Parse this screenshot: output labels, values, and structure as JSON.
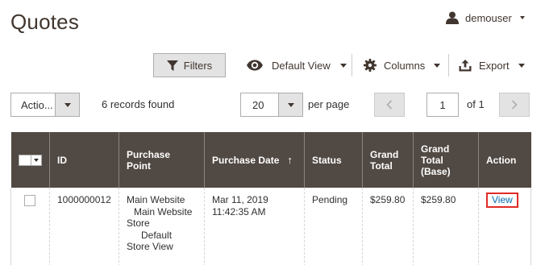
{
  "header": {
    "title": "Quotes",
    "user": {
      "name": "demouser",
      "icon": "user-icon"
    }
  },
  "toolbar": {
    "filters_label": "Filters",
    "view_label": "Default View",
    "columns_label": "Columns",
    "export_label": "Export"
  },
  "actions": {
    "label": "Actio..."
  },
  "records": {
    "text": "6 records found"
  },
  "pager": {
    "per_page_value": "20",
    "per_page_label": "per page",
    "current_page": "1",
    "of_label": "of 1"
  },
  "grid": {
    "columns": {
      "id": "ID",
      "purchase_point": "Purchase Point",
      "purchase_date": "Purchase Date",
      "sort_arrow": "↑",
      "status": "Status",
      "grand_total_1": "Grand",
      "grand_total_2": "Total",
      "grand_total_base_1": "Grand",
      "grand_total_base_2": "Total",
      "grand_total_base_3": "(Base)",
      "action": "Action"
    },
    "rows": [
      {
        "id": "1000000012",
        "purchase_point": [
          "Main Website",
          "Main Website",
          "Store",
          "Default",
          "Store View"
        ],
        "purchase_date": [
          "Mar 11, 2019",
          "11:42:35 AM"
        ],
        "status": "Pending",
        "grand_total": "$259.80",
        "grand_total_base": "$259.80",
        "action": "View"
      }
    ]
  },
  "colors": {
    "header_bg": "#514943",
    "title": "#41362f",
    "link": "#006bb4",
    "highlight": "#e02b27",
    "button_bg": "#e3e3e3"
  }
}
